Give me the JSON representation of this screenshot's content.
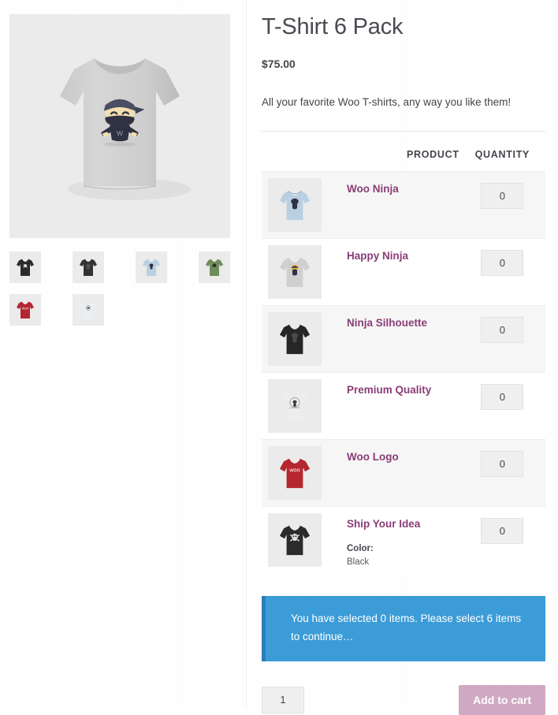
{
  "product": {
    "title": "T-Shirt 6 Pack",
    "price": "$75.00",
    "short_description": "All your favorite Woo T-shirts, any way you like them!",
    "main_image_alt": "gray-tshirt-ninja"
  },
  "gallery": {
    "thumbnails": [
      {
        "name": "thumb-black-skull",
        "shirt_color": "#2b2b2b",
        "graphic": "skull"
      },
      {
        "name": "thumb-black-ninja",
        "shirt_color": "#333333",
        "graphic": "ninja"
      },
      {
        "name": "thumb-blue-ninja",
        "shirt_color": "#b9cfe2",
        "graphic": "ninja"
      },
      {
        "name": "thumb-green-skull",
        "shirt_color": "#6f8c5a",
        "graphic": "skull"
      },
      {
        "name": "thumb-red-woo",
        "shirt_color": "#b52630",
        "graphic": "woo"
      },
      {
        "name": "thumb-white-ninja",
        "shirt_color": "#eceff1",
        "graphic": "ninja"
      }
    ]
  },
  "bundle_table": {
    "headers": {
      "thumbnail": "",
      "product": "PRODUCT",
      "quantity": "QUANTITY"
    },
    "rows": [
      {
        "name": "Woo Ninja",
        "quantity": "0",
        "shirt_color": "#b9cfe2",
        "graphic": "ninja"
      },
      {
        "name": "Happy Ninja",
        "quantity": "0",
        "shirt_color": "#cfcfcf",
        "graphic": "ninja-gold"
      },
      {
        "name": "Ninja Silhouette",
        "quantity": "0",
        "shirt_color": "#262626",
        "graphic": "ninja"
      },
      {
        "name": "Premium Quality",
        "quantity": "0",
        "shirt_color": "#ededed",
        "graphic": "ninja"
      },
      {
        "name": "Woo Logo",
        "quantity": "0",
        "shirt_color": "#b52630",
        "graphic": "woo"
      },
      {
        "name": "Ship Your Idea",
        "quantity": "0",
        "shirt_color": "#2b2b2b",
        "graphic": "skull",
        "variation_label": "Color:",
        "variation_value": "Black"
      }
    ]
  },
  "notice": {
    "message": "You have selected 0 items. Please select 6 items to continue…",
    "background_color": "#3c9cd7",
    "border_color": "#2a7fb5"
  },
  "cart": {
    "quantity": "1",
    "add_to_cart_label": "Add to cart",
    "button_color": "#cfa9c3"
  },
  "colors": {
    "link": "#8a3d76",
    "text": "#43454b",
    "image_bg": "#ebebeb",
    "row_alt": "#f6f6f6"
  }
}
